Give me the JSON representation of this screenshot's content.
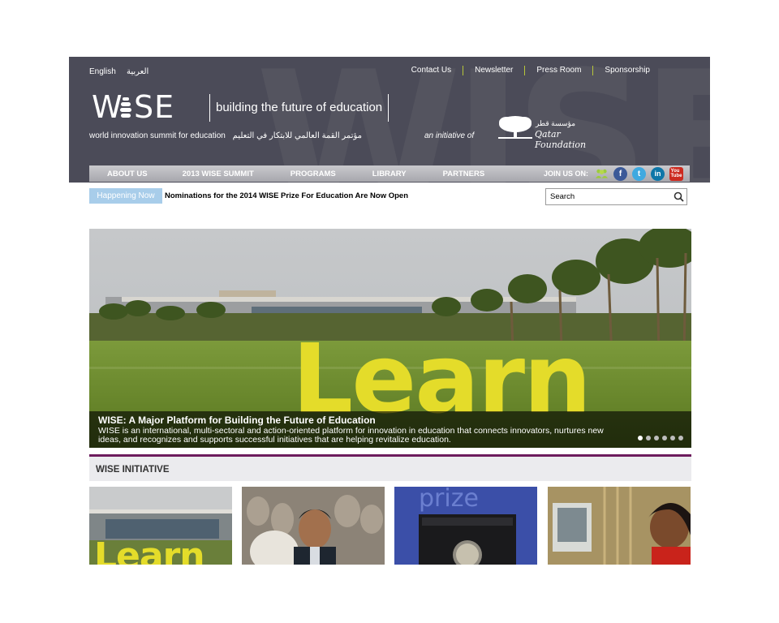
{
  "header": {
    "lang_en": "English",
    "lang_ar": "العربية",
    "top_links": [
      "Contact Us",
      "Newsletter",
      "Press Room",
      "Sponsorship"
    ],
    "logo_text": "WISE",
    "tagline": "building the future of education",
    "subline_en": "world innovation summit for education",
    "subline_ar": "مؤتمر القمة العالمي للابتكار في التعليم",
    "initiative": "an initiative of",
    "qf_arabic": "مؤسسة قطر",
    "qf_name": "Qatar Foundation"
  },
  "nav": {
    "items": [
      "ABOUT US",
      "2013 WISE SUMMIT",
      "PROGRAMS",
      "LIBRARY",
      "PARTNERS"
    ],
    "join_label": "JOIN US ON:",
    "social_icons": [
      "community-icon",
      "facebook-icon",
      "twitter-icon",
      "linkedin-icon",
      "youtube-icon"
    ]
  },
  "ticker": {
    "badge": "Happening Now",
    "headline": "Nominations for the 2014 WISE Prize For Education Are Now Open"
  },
  "search": {
    "placeholder": "Search"
  },
  "hero": {
    "sculpture_text": "Learn",
    "title": "WISE: A Major Platform for Building the Future of Education",
    "text": "WISE is an international, multi-sectoral and action-oriented platform for innovation in education that connects innovators, nurtures new ideas, and recognizes and supports successful initiatives that are helping revitalize education.",
    "slide_count": 6,
    "active_slide": 0
  },
  "initiative": {
    "title": "WISE INITIATIVE",
    "thumbnails": [
      "learn-sculpture-photo",
      "speaker-photo",
      "prize-medal-photo",
      "student-computer-photo"
    ]
  },
  "colors": {
    "header_bg": "#4b4b58",
    "accent_lime": "#b7c63a",
    "happening_blue": "#a8cdea",
    "section_rule": "#6d1c5d",
    "learn_yellow": "#e4dc2a"
  }
}
